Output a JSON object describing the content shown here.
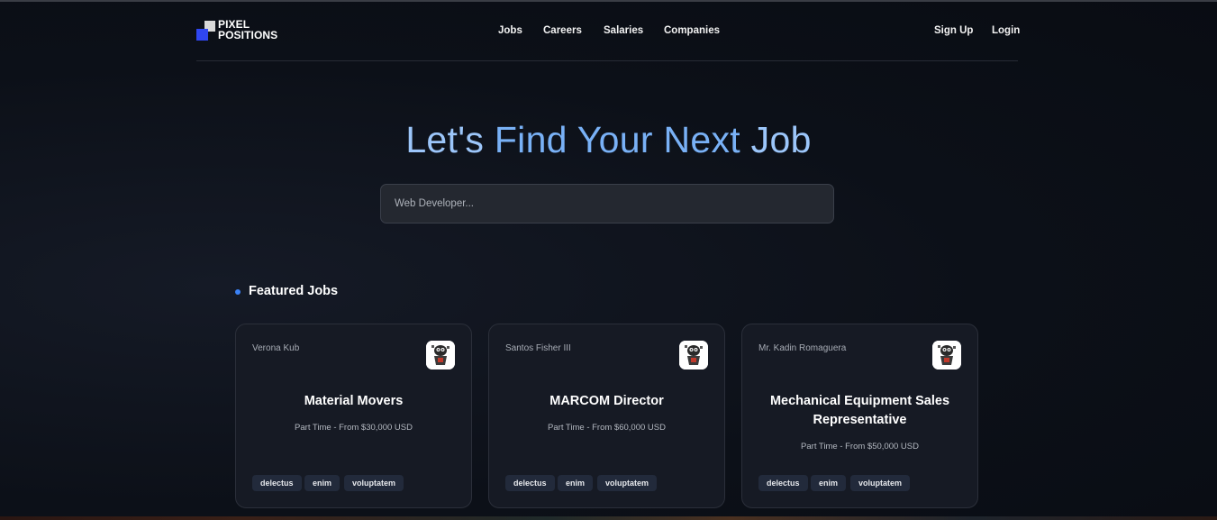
{
  "header": {
    "logo_line1": "PIXEL",
    "logo_line2": "POSITIONS",
    "nav": [
      "Jobs",
      "Careers",
      "Salaries",
      "Companies"
    ],
    "auth": [
      "Sign Up",
      "Login"
    ]
  },
  "hero": {
    "title_part1": "Let's ",
    "title_part2": "Find Your Next",
    "title_part3": " Job",
    "search_placeholder": "Web Developer..."
  },
  "featured": {
    "heading": "Featured Jobs",
    "jobs": [
      {
        "company": "Verona Kub",
        "title": "Material Movers",
        "meta": "Part Time - From $30,000 USD",
        "tags": [
          "delectus",
          "enim",
          "voluptatem"
        ]
      },
      {
        "company": "Santos Fisher III",
        "title": "MARCOM Director",
        "meta": "Part Time - From $60,000 USD",
        "tags": [
          "delectus",
          "enim",
          "voluptatem"
        ]
      },
      {
        "company": "Mr. Kadin Romaguera",
        "title": "Mechanical Equipment Sales Representative",
        "meta": "Part Time - From $50,000 USD",
        "tags": [
          "delectus",
          "enim",
          "voluptatem"
        ]
      }
    ]
  },
  "colors": {
    "background": "#0b0e15",
    "accent": "#3b82f6",
    "hero_title": "#9cc6fa",
    "card": "#161a24",
    "tag": "#222a3b"
  }
}
